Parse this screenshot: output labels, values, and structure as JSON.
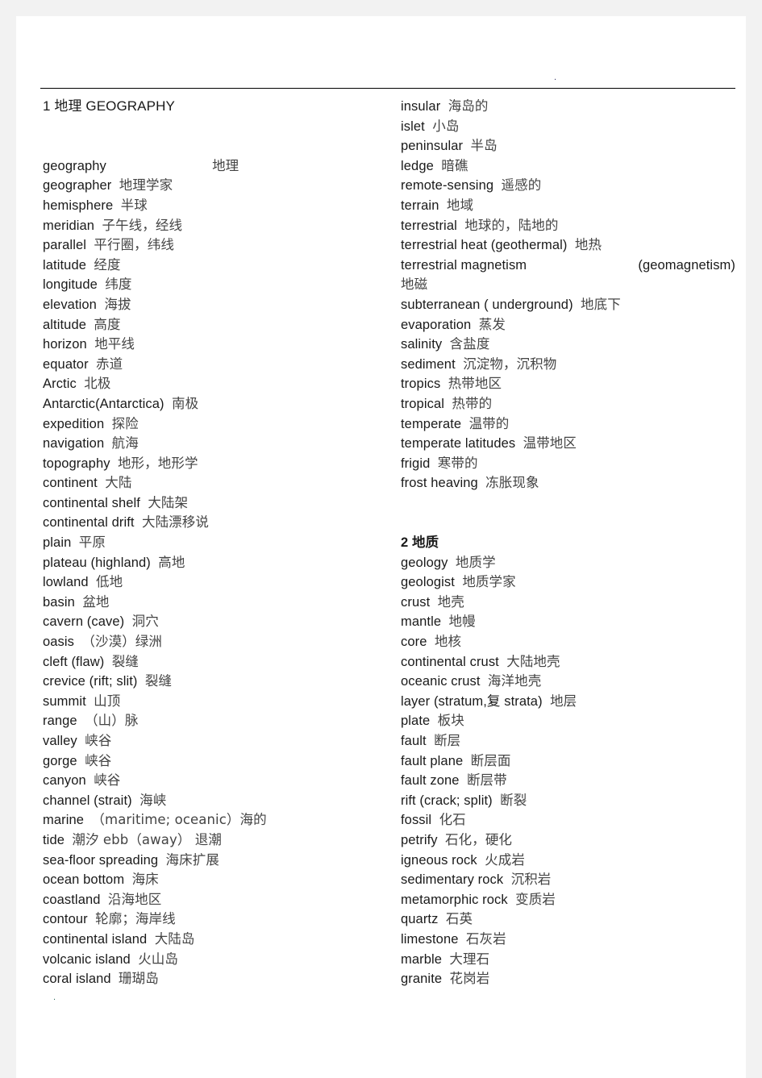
{
  "document": {
    "title": "1 地理 GEOGRAPHY",
    "header_number": "1",
    "header_zh": "地理",
    "header_en": "GEOGRAPHY",
    "stray_mark_top": ".",
    "stray_mark_bottom": "."
  },
  "sections": [
    {
      "id": "geography",
      "heading": "1 地理 GEOGRAPHY",
      "column": "left",
      "entries": [
        {
          "en": "geography",
          "zh": "地理",
          "wide": true
        },
        {
          "en": "geographer",
          "zh": "地理学家"
        },
        {
          "en": "hemisphere",
          "zh": "半球"
        },
        {
          "en": "meridian",
          "zh": "子午线，经线"
        },
        {
          "en": "parallel",
          "zh": "平行圈，纬线"
        },
        {
          "en": "latitude",
          "zh": "经度"
        },
        {
          "en": "longitude",
          "zh": "纬度"
        },
        {
          "en": "elevation",
          "zh": "海拔"
        },
        {
          "en": "altitude",
          "zh": "高度"
        },
        {
          "en": "horizon",
          "zh": "地平线"
        },
        {
          "en": "equator",
          "zh": "赤道"
        },
        {
          "en": "Arctic",
          "zh": "北极"
        },
        {
          "en": "Antarctic(Antarctica)",
          "zh": "南极"
        },
        {
          "en": "expedition",
          "zh": "探险"
        },
        {
          "en": "navigation",
          "zh": "航海"
        },
        {
          "en": "topography",
          "zh": "地形，地形学"
        },
        {
          "en": "continent",
          "zh": "大陆"
        },
        {
          "en": "continental shelf",
          "zh": "大陆架"
        },
        {
          "en": "continental drift",
          "zh": "大陆漂移说"
        },
        {
          "en": "plain",
          "zh": "平原"
        },
        {
          "en": "plateau (highland)",
          "zh": "高地"
        },
        {
          "en": "lowland",
          "zh": "低地"
        },
        {
          "en": "basin",
          "zh": "盆地"
        },
        {
          "en": "cavern (cave)",
          "zh": "洞穴"
        },
        {
          "en": "oasis",
          "zh": "（沙漠）绿洲"
        },
        {
          "en": "cleft (flaw)",
          "zh": "裂缝"
        },
        {
          "en": "crevice (rift; slit)",
          "zh": "裂缝"
        },
        {
          "en": "summit",
          "zh": "山顶"
        },
        {
          "en": "range",
          "zh": "（山）脉"
        },
        {
          "en": "valley",
          "zh": "峡谷"
        },
        {
          "en": "gorge",
          "zh": "峡谷"
        },
        {
          "en": "canyon",
          "zh": "峡谷"
        },
        {
          "en": "channel (strait)",
          "zh": "海峡"
        },
        {
          "en": "marine",
          "zh": "（maritime; oceanic）海的"
        },
        {
          "en": "tide",
          "zh": "潮汐 ebb（away） 退潮",
          "mixed": true
        },
        {
          "en": "sea-floor spreading",
          "zh": "海床扩展"
        },
        {
          "en": "ocean bottom",
          "zh": "海床"
        },
        {
          "en": "coastland",
          "zh": "沿海地区"
        },
        {
          "en": "contour",
          "zh": "轮廓；海岸线"
        },
        {
          "en": "continental island",
          "zh": "大陆岛"
        },
        {
          "en": "volcanic island",
          "zh": "火山岛"
        },
        {
          "en": "coral island",
          "zh": "珊瑚岛"
        }
      ]
    },
    {
      "id": "geography-cont",
      "column": "right",
      "entries": [
        {
          "en": "insular",
          "zh": "海岛的"
        },
        {
          "en": "islet",
          "zh": "小岛"
        },
        {
          "en": "peninsular",
          "zh": "半岛"
        },
        {
          "en": "ledge",
          "zh": "暗礁"
        },
        {
          "en": "remote-sensing",
          "zh": "遥感的"
        },
        {
          "en": "terrain",
          "zh": "地域"
        },
        {
          "en": "terrestrial",
          "zh": "地球的，陆地的"
        },
        {
          "en": "terrestrial heat (geothermal)",
          "zh": "地热"
        },
        {
          "en": "terrestrial magnetism",
          "paren": "(geomagnetism)",
          "zh": "地磁",
          "justified": true
        },
        {
          "en": "subterranean ( underground)",
          "zh": "地底下"
        },
        {
          "en": "evaporation",
          "zh": "蒸发"
        },
        {
          "en": "salinity",
          "zh": "含盐度"
        },
        {
          "en": "sediment",
          "zh": "沉淀物，沉积物"
        },
        {
          "en": "tropics",
          "zh": "热带地区"
        },
        {
          "en": "tropical",
          "zh": "热带的"
        },
        {
          "en": "temperate",
          "zh": "温带的"
        },
        {
          "en": "temperate latitudes",
          "zh": "温带地区"
        },
        {
          "en": "frigid",
          "zh": "寒带的"
        },
        {
          "en": "frost heaving",
          "zh": "冻胀现象"
        }
      ]
    },
    {
      "id": "geology",
      "heading": "2 地质",
      "heading_number": "2",
      "heading_zh": "地质",
      "column": "right",
      "entries": [
        {
          "en": "geology",
          "zh": "地质学"
        },
        {
          "en": "geologist",
          "zh": "地质学家"
        },
        {
          "en": "crust",
          "zh": "地壳"
        },
        {
          "en": "mantle",
          "zh": "地幔"
        },
        {
          "en": "core",
          "zh": "地核"
        },
        {
          "en": "continental crust",
          "zh": "大陆地壳"
        },
        {
          "en": "oceanic crust",
          "zh": "海洋地壳"
        },
        {
          "en": "layer (stratum,复 strata)",
          "zh": "地层"
        },
        {
          "en": "plate",
          "zh": "板块"
        },
        {
          "en": "fault",
          "zh": "断层"
        },
        {
          "en": "fault plane",
          "zh": "断层面"
        },
        {
          "en": "fault zone",
          "zh": "断层带"
        },
        {
          "en": "rift (crack; split)",
          "zh": "断裂"
        },
        {
          "en": "fossil",
          "zh": "化石"
        },
        {
          "en": "petrify",
          "zh": "石化，硬化"
        },
        {
          "en": "igneous rock",
          "zh": "火成岩"
        },
        {
          "en": "sedimentary rock",
          "zh": "沉积岩"
        },
        {
          "en": "metamorphic rock",
          "zh": "变质岩"
        },
        {
          "en": "quartz",
          "zh": "石英"
        },
        {
          "en": "limestone",
          "zh": "石灰岩"
        },
        {
          "en": "marble",
          "zh": "大理石"
        },
        {
          "en": "granite",
          "zh": "花岗岩"
        }
      ]
    }
  ],
  "colors": {
    "page_background": "#ffffff",
    "outer_background": "#f2f2f2",
    "english_text": "#1a1a1a",
    "chinese_text": "#444444",
    "rule": "#000000"
  }
}
